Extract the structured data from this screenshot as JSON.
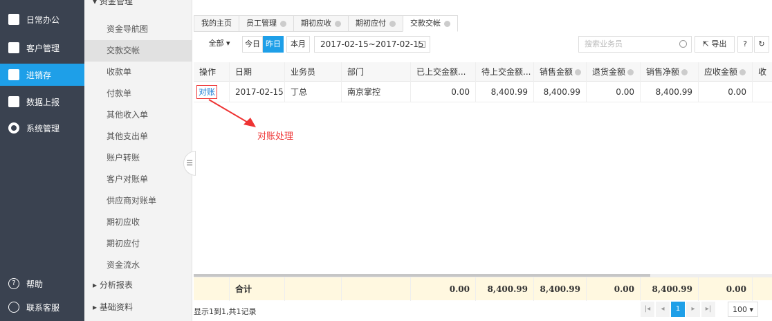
{
  "sidebar": {
    "items": [
      {
        "label": "日常办公",
        "icon": "briefcase-icon"
      },
      {
        "label": "客户管理",
        "icon": "building-icon"
      },
      {
        "label": "进销存",
        "icon": "box-icon"
      },
      {
        "label": "数据上报",
        "icon": "upload-icon"
      },
      {
        "label": "系统管理",
        "icon": "gear-icon"
      }
    ],
    "help_label": "帮助",
    "help_glyph": "?",
    "contact_label": "联系客服",
    "active_color": "#1e9fe8"
  },
  "submenu": {
    "section_title": "▾ 资金管理",
    "items": [
      "资金导航图",
      "交款交帐",
      "收款单",
      "付款单",
      "其他收入单",
      "其他支出单",
      "账户转账",
      "客户对账单",
      "供应商对账单",
      "期初应收",
      "期初应付",
      "资金流水"
    ],
    "active_index": 1,
    "section_analysis": "▸ 分析报表",
    "section_basic": "▸ 基础资料"
  },
  "tabs": [
    {
      "label": "我的主页",
      "closable": false
    },
    {
      "label": "员工管理",
      "closable": true
    },
    {
      "label": "期初应收",
      "closable": true
    },
    {
      "label": "期初应付",
      "closable": true
    },
    {
      "label": "交款交帐",
      "closable": true
    }
  ],
  "toolbar": {
    "all_label": "全部 ▾",
    "today_label": "今日",
    "yesterday_label": "昨日",
    "month_label": "本月",
    "date_range": "2017-02-15~2017-02-15",
    "search_placeholder": "搜索业务员",
    "export_label": "导出",
    "help_glyph": "?",
    "refresh_glyph": "↻"
  },
  "table": {
    "headers": [
      "操作",
      "日期",
      "业务员",
      "部门",
      "已上交金额...",
      "待上交金额...",
      "销售金额",
      "退货金额",
      "销售净额",
      "应收金额",
      "收"
    ],
    "row": {
      "action": "对账",
      "date": "2017-02-15",
      "salesperson": "丁总",
      "department": "南京掌控",
      "submitted": "0.00",
      "pending": "8,400.99",
      "sales": "8,400.99",
      "returns": "0.00",
      "net": "8,400.99",
      "receivable": "0.00"
    },
    "footer": {
      "label": "合计",
      "submitted": "0.00",
      "pending": "8,400.99",
      "sales": "8,400.99",
      "returns": "0.00",
      "net": "8,400.99",
      "receivable": "0.00"
    }
  },
  "annotation": "对账处理",
  "pager": {
    "info": "显示1到1,共1记录",
    "current_page": "1",
    "page_size": "100 ▾"
  }
}
